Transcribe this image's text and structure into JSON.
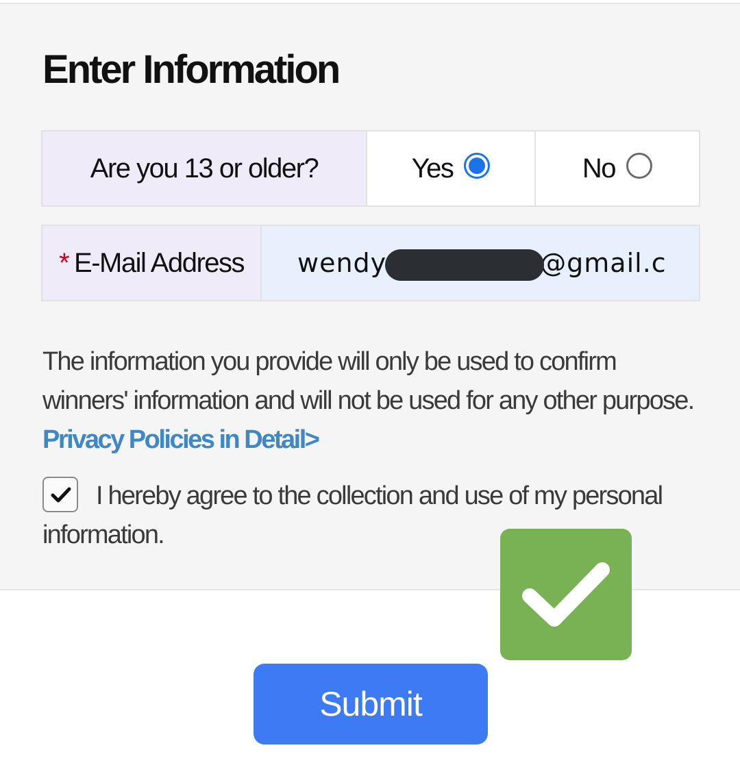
{
  "form": {
    "title": "Enter Information",
    "age_question": {
      "label": "Are you 13 or older?",
      "options": [
        {
          "label": "Yes",
          "selected": true
        },
        {
          "label": "No",
          "selected": false
        }
      ]
    },
    "email": {
      "required_marker": "*",
      "label": "E-Mail Address",
      "value_prefix": "wendy",
      "value_suffix": "@gmail.c"
    },
    "notice": {
      "text": "The information you provide will only be used to confirm winners' information and will not be used for any other purpose. ",
      "link_text": "Privacy Policies in Detail>"
    },
    "consent": {
      "checked": true,
      "text": "I hereby agree to the collection and use of my personal information."
    }
  },
  "submit_button": {
    "label": "Submit"
  },
  "colors": {
    "accent": "#1a73e8",
    "button": "#3d7bf5",
    "badge": "#79b254",
    "link": "#3f88c5",
    "required": "#d0021b"
  },
  "icons": {
    "badge": "checkmark-icon",
    "checkbox": "check-icon",
    "redaction": "redaction-bar"
  }
}
